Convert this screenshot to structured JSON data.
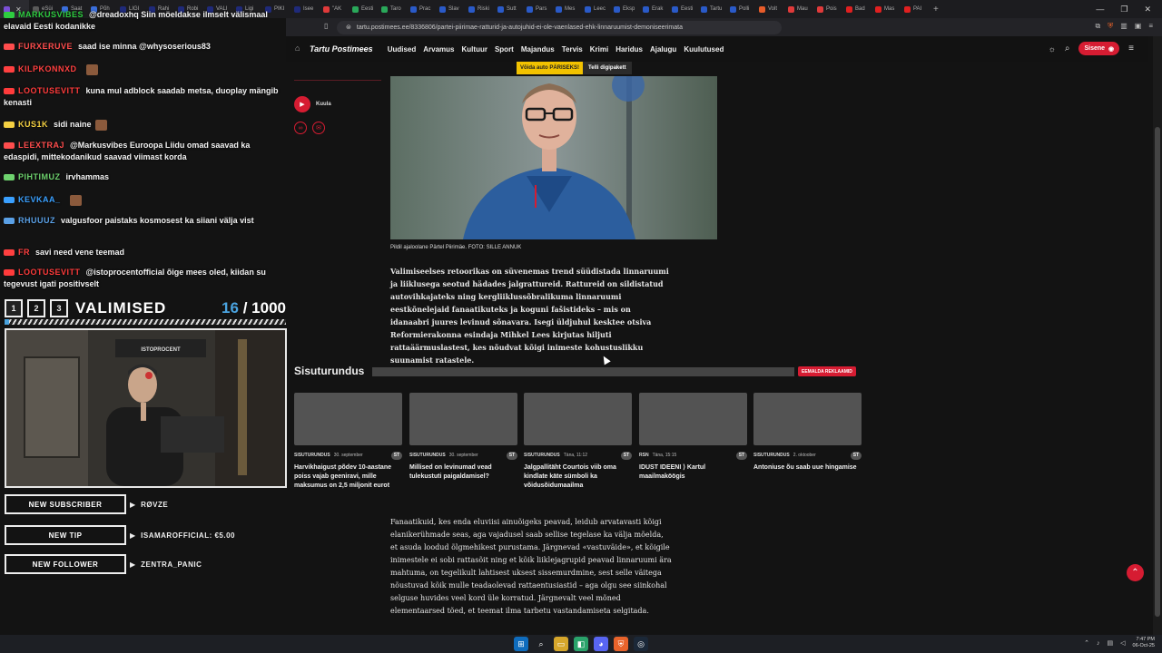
{
  "browser": {
    "tabs": [
      {
        "label": "",
        "color": "#7b4fd6",
        "active": true
      },
      {
        "label": "eSüi",
        "color": "#5a5a5a"
      },
      {
        "label": "Saat",
        "color": "#3a6edb"
      },
      {
        "label": "Põh",
        "color": "#3a6edb"
      },
      {
        "label": "LIGI",
        "color": "#1f2a7a"
      },
      {
        "label": "Rahi",
        "color": "#1f2a7a"
      },
      {
        "label": "Robi",
        "color": "#1f2a7a"
      },
      {
        "label": "VALI",
        "color": "#1f2a7a"
      },
      {
        "label": "Ligi",
        "color": "#1f2a7a"
      },
      {
        "label": "PIKI",
        "color": "#1f2a7a"
      },
      {
        "label": "Isee",
        "color": "#1f2a7a"
      },
      {
        "label": "\"AK",
        "color": "#e03a3a"
      },
      {
        "label": "Eesti",
        "color": "#2aa85a"
      },
      {
        "label": "Taro",
        "color": "#2aa85a"
      },
      {
        "label": "Prac",
        "color": "#2a5ac8"
      },
      {
        "label": "Slav",
        "color": "#2a5ac8"
      },
      {
        "label": "Riski",
        "color": "#2a5ac8"
      },
      {
        "label": "Sutt",
        "color": "#2a5ac8"
      },
      {
        "label": "Pars",
        "color": "#2a5ac8"
      },
      {
        "label": "Mes",
        "color": "#2a5ac8"
      },
      {
        "label": "Leec",
        "color": "#2a5ac8"
      },
      {
        "label": "Eksp",
        "color": "#2a5ac8"
      },
      {
        "label": "Erak",
        "color": "#2a5ac8"
      },
      {
        "label": "Eesti",
        "color": "#2a5ac8"
      },
      {
        "label": "Tartu",
        "color": "#2a5ac8"
      },
      {
        "label": "Polli",
        "color": "#2a5ac8"
      },
      {
        "label": "Volt",
        "color": "#e85c2a"
      },
      {
        "label": "Mau",
        "color": "#e03a3a"
      },
      {
        "label": "Pois",
        "color": "#e03a3a"
      },
      {
        "label": "Bad",
        "color": "#e02020"
      },
      {
        "label": "Mas",
        "color": "#e02020"
      },
      {
        "label": "PAI",
        "color": "#e02020"
      }
    ],
    "url": "tartu.postimees.ee/8336806/partei-piirimae-ratturid-ja-autojuhid-ei-ole-vaenlased-ehk-linnaruumist-demoniseerimata"
  },
  "chat": [
    {
      "name": "MARKUSVIBES",
      "color": "#2ecc40",
      "text": "@dreadoxhq Siin möeldakse ilmselt välismaal elavaid Eesti kodanikke",
      "emote": false
    },
    {
      "name": "FURXERUVE",
      "color": "#ff4d4d",
      "text": "saad ise minna @whysoserious83",
      "emote": false
    },
    {
      "name": "KILPKONNXD",
      "color": "#ff4040",
      "text": "",
      "emote": true
    },
    {
      "name": "LOOTUSEVITT",
      "color": "#ff3b3b",
      "text": "kuna mul adblock saadab metsa, duoplay mängib kenasti",
      "emote": false
    },
    {
      "name": "KUS1K",
      "color": "#f5d142",
      "text": "sidi naine",
      "emote": true
    },
    {
      "name": "LEEXTRAJ",
      "color": "#ff4d4d",
      "text": "@Markusvibes Euroopa Liidu omad saavad ka edaspidi, mittekodanikud saavad viimast korda",
      "emote": false
    },
    {
      "name": "PIHTIMUZ",
      "color": "#6ed26e",
      "text": "irvhammas",
      "emote": false
    },
    {
      "name": "KEVKAA_",
      "color": "#3aa0ff",
      "text": "",
      "emote": true
    },
    {
      "name": "RHUUUZ",
      "color": "#5aa0e6",
      "text": "valgusfoor paistaks kosmosest ka siiani välja vist",
      "emote": false
    },
    {
      "name": "FR",
      "color": "#ff4040",
      "text": "savi need vene teemad",
      "emote": false
    },
    {
      "name": "LOOTUSEVITT",
      "color": "#ff3b3b",
      "text": "@istoprocentofficial õige mees oled, kiidan su tegevust igati positivselt",
      "emote": false
    }
  ],
  "goal": {
    "nums": [
      "1",
      "2",
      "3"
    ],
    "title": "VALIMISED",
    "current": "16",
    "separator": "/",
    "target": "1000",
    "progress": 0.016
  },
  "webcam": {
    "sign": "ISTOPROCENT"
  },
  "alerts": [
    {
      "label": "NEW SUBSCRIBER",
      "value": "RØVZE"
    },
    {
      "label": "NEW TIP",
      "value": "ISAMAROFFICIAL: €5.00"
    },
    {
      "label": "NEW FOLLOWER",
      "value": "ZENTRA_PANIC"
    }
  ],
  "site": {
    "logo": "Tartu Postimees",
    "nav": [
      "Uudised",
      "Arvamus",
      "Kultuur",
      "Sport",
      "Majandus",
      "Tervis",
      "Krimi",
      "Haridus",
      "Ajalugu",
      "Kuulutused"
    ],
    "login": "Sisene",
    "promo_left": "Võida auto PÄRISEKS!",
    "promo_right": "Telli digipakett",
    "listen": "Kuula"
  },
  "article": {
    "caption": "Pildil ajaloolane Pärtel Piirimäe. FOTO: SILLE ANNUK",
    "para1": "Valimiseelses retoorikas on süvenemas trend süüdistada linnaruumi ja liiklusega seotud hädades jalgrattureid. Rattureid on sildistatud autovihkajateks ning kergliiklussõbralikuma linnaruumi eestkõnelejaid fanaatikuteks ja koguni fašistideks – mis on idanaabri juures levinud sõnavara. Isegi üldjuhul kesktee otsiva Reformierakonna esindaja Mihkel Lees kirjutas hiljuti rattaäärmuslastest, kes nõudvat kõigi inimeste kohustuslikku suunamist ratastele.",
    "para2": "Fanaatikuid, kes enda eluviisi ainuõigeks peavad, leidub arvatavasti kõigi elanikerühmade seas, aga vajadusel saab sellise tegelase ka välja mõelda, et asuda loodud õlgmehikest purustama. Järgnevad «vastuväide», et kõigile inimestele ei sobi rattasõit ning et kõik liiklejagrupid peavad linnaruumi ära mahtuma, on tegelikult lahtisest uksest sissemurdmine, sest selle väitega nõustuvad kõik mulle teadaolevad rattaentusiastid – aga olgu see siinkohal selguse huvides veel kord üle korratud. Järgnevalt veel mõned elementaarsed tõed, et teemat ilma tarbetu vastandamiseta selgitada."
  },
  "sponsored": {
    "title": "Sisuturundus",
    "remove": "EEMALDA REKLAAMID",
    "cards": [
      {
        "source": "SISUTURUNDUS",
        "date": "30. september",
        "tag": "ST",
        "title": "Harvikhaigust põdev 10-aastane poiss vajab geeniravi, mille maksumus on 2,5 miljonit eurot"
      },
      {
        "source": "SISUTURUNDUS",
        "date": "30. september",
        "tag": "ST",
        "title": "Millised on levinumad vead tulekustuti paigaldamisel?"
      },
      {
        "source": "SISUTURUNDUS",
        "date": "Täna, 11:12",
        "tag": "ST",
        "title": "Jalgpallitäht Courtois viib oma kindlate käte sümboli ka võidusõidumaailma"
      },
      {
        "source": "RSN",
        "date": "Täna, 15:15",
        "tag": "ST",
        "title": "IDUST IDEENI ⟩ Kartul maailmaköögis"
      },
      {
        "source": "SISUTURUNDUS",
        "date": "2. oktoober",
        "tag": "ST",
        "title": "Antoniuse õu saab uue hingamise"
      }
    ]
  },
  "taskbar": {
    "time": "7:47 PM",
    "date": "06-Oct-25"
  },
  "colors": {
    "accent_red": "#d61c32",
    "goal_blue": "#4aa3df"
  }
}
